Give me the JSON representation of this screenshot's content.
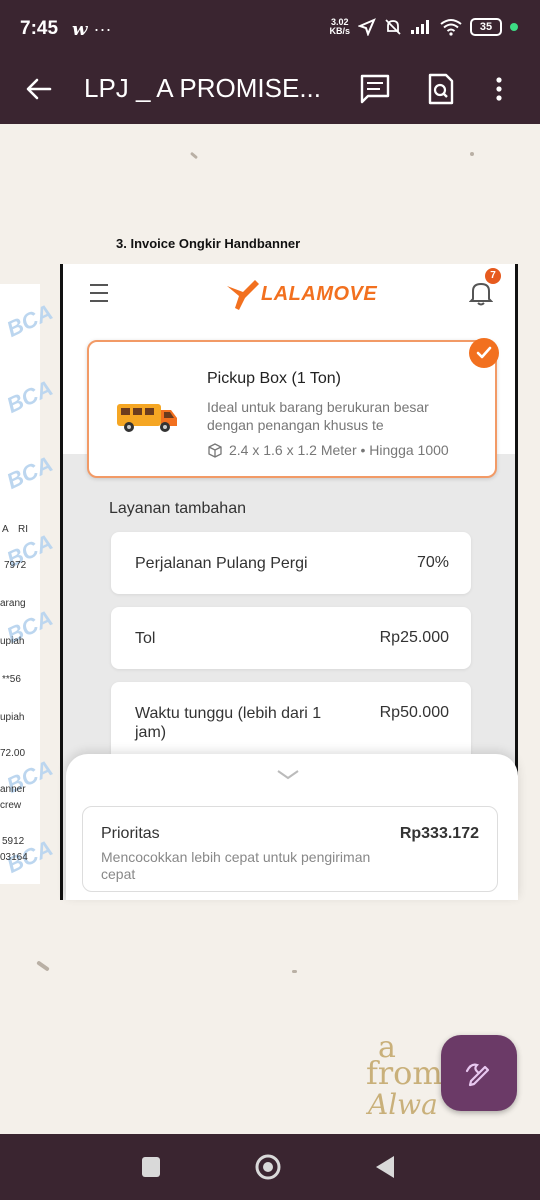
{
  "status_bar": {
    "time": "7:45",
    "app_glyph": "w",
    "more_dots": "···",
    "speed_value": "3.02",
    "speed_unit": "KB/s",
    "battery": "35",
    "icons": [
      "navigation-icon",
      "mute-icon",
      "signal-icon",
      "wifi-icon",
      "battery-icon"
    ]
  },
  "app_bar": {
    "title": "LPJ _ A PROMISE...",
    "icons": [
      "back-arrow-icon",
      "comment-icon",
      "search-page-icon",
      "more-vert-icon"
    ]
  },
  "document": {
    "heading": "3. Invoice Ongkir Handbanner",
    "left_strip_text": [
      "A",
      "RI",
      "7972",
      "arang",
      "upiah",
      "**56",
      "upiah",
      "72.00",
      "anner",
      "crew",
      "5912",
      "03164"
    ],
    "watermark_text": "BCA",
    "embedded_screenshot": {
      "logo_text": "LALAMOVE",
      "notification_count": "7",
      "vehicle": {
        "name": "Pickup Box (1 Ton)",
        "description": "Ideal untuk barang berukuran besar dengan penangan khusus te",
        "dimensions": "2.4 x 1.6 x 1.2 Meter • Hingga 1000"
      },
      "additional_services_title": "Layanan tambahan",
      "services": [
        {
          "label": "Perjalanan Pulang Pergi",
          "price": "70%"
        },
        {
          "label": "Tol",
          "price": "Rp25.000"
        },
        {
          "label": "Waktu tunggu (lebih dari 1 jam)",
          "price": "Rp50.000"
        }
      ],
      "priority": {
        "name": "Prioritas",
        "price": "Rp333.172",
        "description": "Mencocokkan lebih cepat untuk pengiriman cepat"
      },
      "colors": {
        "brand": "#f2701f",
        "card_border": "#f29a66"
      }
    },
    "corner_watermark": {
      "line1": "a",
      "line2": "from",
      "line3": "Alwa"
    }
  },
  "fab": {
    "icon": "edit-pen-icon",
    "color": "#6b3a67"
  },
  "nav_bar": {
    "icons": [
      "recent-apps-icon",
      "home-icon",
      "back-icon"
    ]
  }
}
